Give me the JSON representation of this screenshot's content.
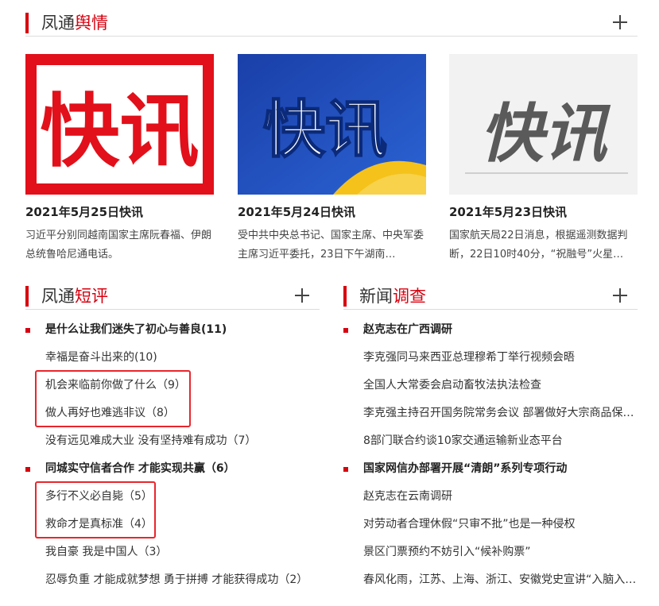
{
  "top_section": {
    "title_a": "凤通",
    "title_b": "舆情"
  },
  "cards": [
    {
      "image_text": "快讯",
      "title": "2021年5月25日快讯",
      "summary": "习近平分别同越南国家主席阮春福、伊朗总统鲁哈尼通电话。"
    },
    {
      "image_text": "快讯",
      "title": "2021年5月24日快讯",
      "summary": "受中共中央总书记、国家主席、中央军委主席习近平委托，23日下午湖南…"
    },
    {
      "image_text": "快讯",
      "title": "2021年5月23日快讯",
      "summary": "国家航天局22日消息，根据遥测数据判断，22日10时40分，“祝融号”火星…"
    }
  ],
  "left_section": {
    "title_a": "凤通",
    "title_b": "短评",
    "items": [
      {
        "type": "lead",
        "text": "是什么让我们迷失了初心与善良(11)"
      },
      {
        "type": "sub",
        "text": "幸福是奋斗出来的(10)"
      },
      {
        "type": "sub",
        "text": "机会来临前你做了什么（9）"
      },
      {
        "type": "sub",
        "text": "做人再好也难逃非议（8）"
      },
      {
        "type": "sub",
        "text": "没有远见难成大业 没有坚持难有成功（7）"
      },
      {
        "type": "lead",
        "text": "同城实守信者合作 才能实现共赢（6）"
      },
      {
        "type": "sub",
        "text": "多行不义必自毙（5）"
      },
      {
        "type": "sub",
        "text": "救命才是真标准（4）"
      },
      {
        "type": "sub",
        "text": "我自豪 我是中国人（3）"
      },
      {
        "type": "sub",
        "text": "忍辱负重 才能成就梦想 勇于拼搏 才能获得成功（2）"
      }
    ]
  },
  "right_section": {
    "title_a": "新闻",
    "title_b": "调查",
    "items": [
      {
        "type": "lead",
        "text": "赵克志在广西调研"
      },
      {
        "type": "sub",
        "text": "李克强同马来西亚总理穆希丁举行视频会晤"
      },
      {
        "type": "sub",
        "text": "全国人大常委会启动畜牧法执法检查"
      },
      {
        "type": "sub",
        "text": "李克强主持召开国务院常务会议 部署做好大宗商品保…"
      },
      {
        "type": "sub",
        "text": "8部门联合约谈10家交通运输新业态平台"
      },
      {
        "type": "lead",
        "text": "国家网信办部署开展“清朗”系列专项行动"
      },
      {
        "type": "sub",
        "text": "赵克志在云南调研"
      },
      {
        "type": "sub",
        "text": "对劳动者合理休假“只审不批”也是一种侵权"
      },
      {
        "type": "sub",
        "text": "景区门票预约不妨引入“候补购票”"
      },
      {
        "type": "sub",
        "text": "春风化雨，江苏、上海、浙江、安徽党史宣讲“入脑入…"
      }
    ]
  },
  "colors": {
    "accent": "#d7000f",
    "annotation_box": "#e8262d"
  }
}
